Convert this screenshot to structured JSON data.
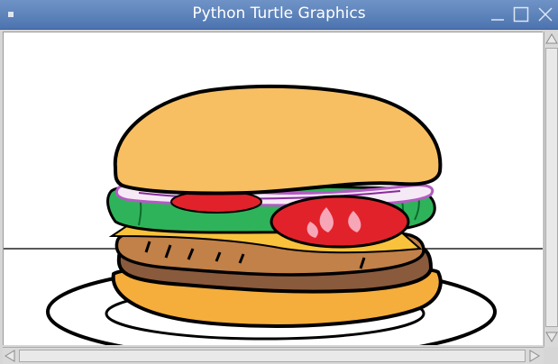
{
  "window": {
    "title": "Python Turtle Graphics"
  },
  "icons": {
    "menu": "window-menu-icon",
    "minimize": "minimize-icon",
    "maximize": "maximize-icon",
    "close": "close-icon",
    "scroll_up": "arrow-up-icon",
    "scroll_down": "arrow-down-icon",
    "scroll_left": "arrow-left-icon",
    "scroll_right": "arrow-right-icon"
  },
  "colors": {
    "titlebar": "#5b7fb8",
    "bun": "#f7bf62",
    "bottom_bun": "#f5ad3c",
    "lettuce": "#2fb35a",
    "tomato": "#e2222a",
    "cheese": "#f9c23c",
    "patty": "#8a5a3c",
    "onion": "#d9a3e0"
  }
}
